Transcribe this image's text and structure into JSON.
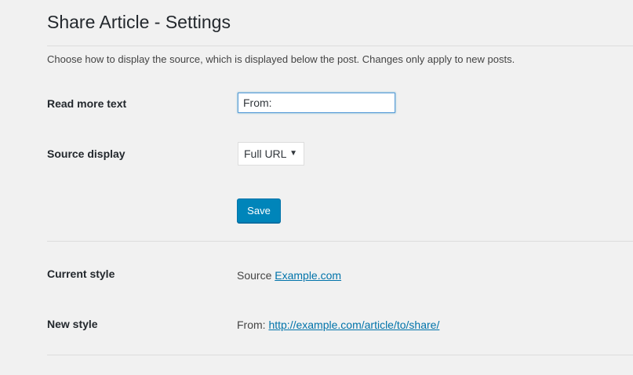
{
  "page": {
    "title": "Share Article - Settings",
    "description": "Choose how to display the source, which is displayed below the post. Changes only apply to new posts."
  },
  "form": {
    "read_more": {
      "label": "Read more text",
      "value": "From:"
    },
    "source_display": {
      "label": "Source display",
      "selected": "Full URL"
    },
    "save_label": "Save"
  },
  "preview": {
    "current": {
      "label": "Current style",
      "prefix": "Source",
      "link_text": "Example.com"
    },
    "new": {
      "label": "New style",
      "prefix": "From:",
      "link_text": "http://example.com/article/to/share/"
    }
  },
  "colors": {
    "background": "#f1f1f1",
    "primary_button": "#0085ba",
    "link": "#0073aa",
    "focus_border": "#5b9dd9"
  }
}
